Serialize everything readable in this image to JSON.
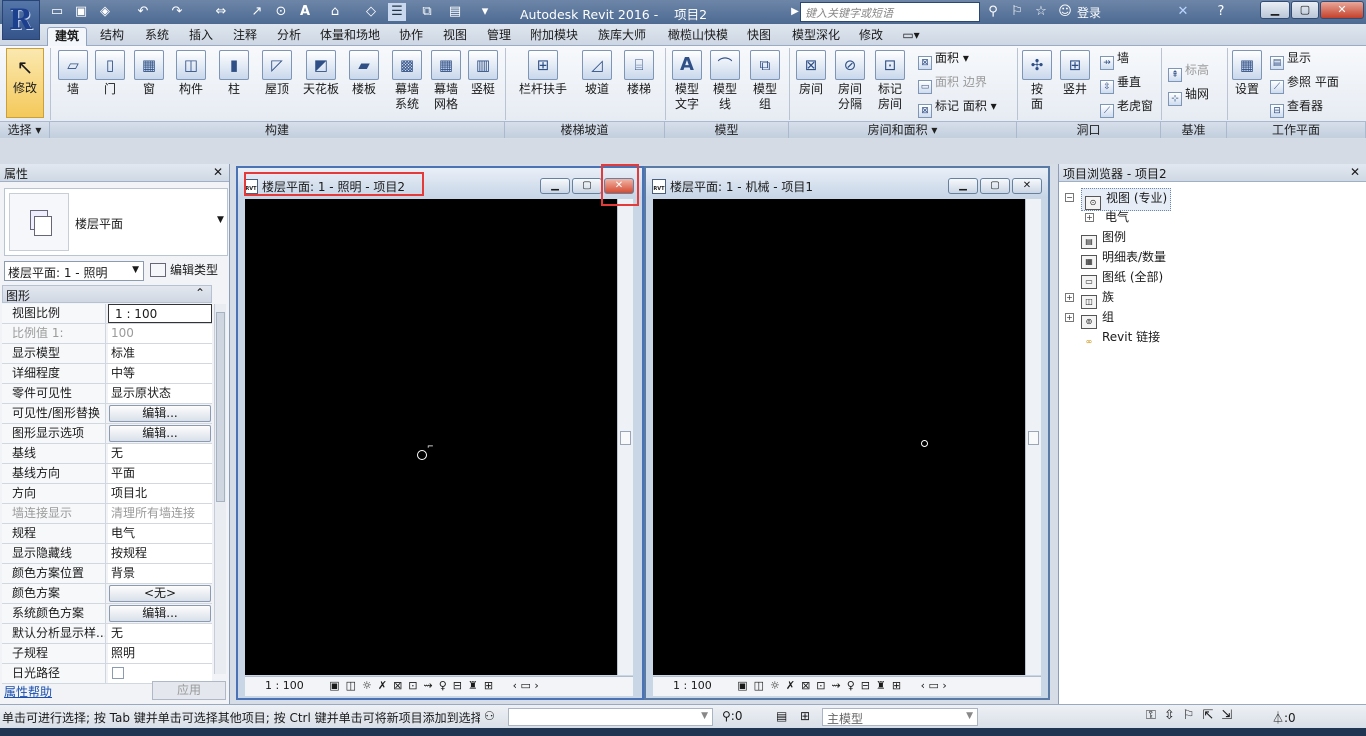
{
  "app": {
    "title": "Autodesk Revit 2016 -",
    "project": "项目2",
    "search_placeholder": "键入关键字或短语",
    "login": "登录",
    "logo": "R"
  },
  "tabs": [
    "建筑",
    "结构",
    "系统",
    "插入",
    "注释",
    "分析",
    "体量和场地",
    "协作",
    "视图",
    "管理",
    "附加模块",
    "族库大师",
    "橄榄山快模",
    "快图",
    "模型深化",
    "修改"
  ],
  "active_tab": "建筑",
  "ribbon": {
    "select_group": "选择",
    "modify": "修改",
    "build_group": "构建",
    "build": [
      "墙",
      "门",
      "窗",
      "构件",
      "柱",
      "屋顶",
      "天花板",
      "楼板",
      "幕墙\n系统",
      "幕墙\n网格",
      "竖梃"
    ],
    "stairs_group": "楼梯坡道",
    "stairs": [
      "栏杆扶手",
      "坡道",
      "楼梯"
    ],
    "model_group": "模型",
    "model": [
      "模型\n文字",
      "模型\n线",
      "模型\n组"
    ],
    "room_group": "房间和面积",
    "room": [
      "房间",
      "房间\n分隔",
      "标记\n房间"
    ],
    "room_small": [
      "面积",
      "面积",
      "边界",
      "标记",
      "面积"
    ],
    "opening_group": "洞口",
    "opening": [
      "按\n面",
      "竖井"
    ],
    "opening_small": [
      "墙",
      "垂直",
      "老虎窗"
    ],
    "datum_group": "基准",
    "datum_small": [
      "标高",
      "轴网"
    ],
    "workplane_group": "工作平面",
    "workplane": [
      "设置"
    ],
    "workplane_small": [
      "显示",
      "参照 平面",
      "查看器"
    ]
  },
  "properties": {
    "title": "属性",
    "type_name": "楼层平面",
    "instance": "楼层平面: 1 - 照明",
    "edit_type": "编辑类型",
    "section": "图形",
    "rows": [
      {
        "k": "视图比例",
        "v": "1 : 100"
      },
      {
        "k": "比例值 1:",
        "v": "100"
      },
      {
        "k": "显示模型",
        "v": "标准"
      },
      {
        "k": "详细程度",
        "v": "中等"
      },
      {
        "k": "零件可见性",
        "v": "显示原状态"
      },
      {
        "k": "可见性/图形替换",
        "v": "编辑..."
      },
      {
        "k": "图形显示选项",
        "v": "编辑..."
      },
      {
        "k": "基线",
        "v": "无"
      },
      {
        "k": "基线方向",
        "v": "平面"
      },
      {
        "k": "方向",
        "v": "项目北"
      },
      {
        "k": "墙连接显示",
        "v": "清理所有墙连接"
      },
      {
        "k": "规程",
        "v": "电气"
      },
      {
        "k": "显示隐藏线",
        "v": "按规程"
      },
      {
        "k": "颜色方案位置",
        "v": "背景"
      },
      {
        "k": "颜色方案",
        "v": "<无>"
      },
      {
        "k": "系统颜色方案",
        "v": "编辑..."
      },
      {
        "k": "默认分析显示样...",
        "v": "无"
      },
      {
        "k": "子规程",
        "v": "照明"
      },
      {
        "k": "日光路径",
        "v": ""
      }
    ],
    "help": "属性帮助",
    "apply": "应用"
  },
  "views": [
    {
      "title": "楼层平面: 1 - 照明 - 项目2",
      "scale": "1 : 100",
      "icon": "RVT"
    },
    {
      "title": "楼层平面: 1 - 机械 - 项目1",
      "scale": "1 : 100",
      "icon": "RVT"
    }
  ],
  "browser": {
    "title": "项目浏览器 - 项目2",
    "items": [
      {
        "label": "视图 (专业)",
        "level": 0,
        "sign": "−"
      },
      {
        "label": "电气",
        "level": 1,
        "sign": "+"
      },
      {
        "label": "图例",
        "level": 0,
        "sign": ""
      },
      {
        "label": "明细表/数量",
        "level": 0,
        "sign": ""
      },
      {
        "label": "图纸 (全部)",
        "level": 0,
        "sign": ""
      },
      {
        "label": "族",
        "level": 0,
        "sign": "+"
      },
      {
        "label": "组",
        "level": 0,
        "sign": "+"
      },
      {
        "label": "Revit 链接",
        "level": 0,
        "sign": ""
      }
    ]
  },
  "status": {
    "hint": "单击可进行选择; 按 Tab 键并单击可选择其他项目; 按 Ctrl 键并单击可将新项目添加到选择",
    "count": ":0",
    "model": "主模型",
    "filter_count": ":0"
  },
  "colors": {
    "highlight": "#e53a3a",
    "canvas": "#000000"
  }
}
